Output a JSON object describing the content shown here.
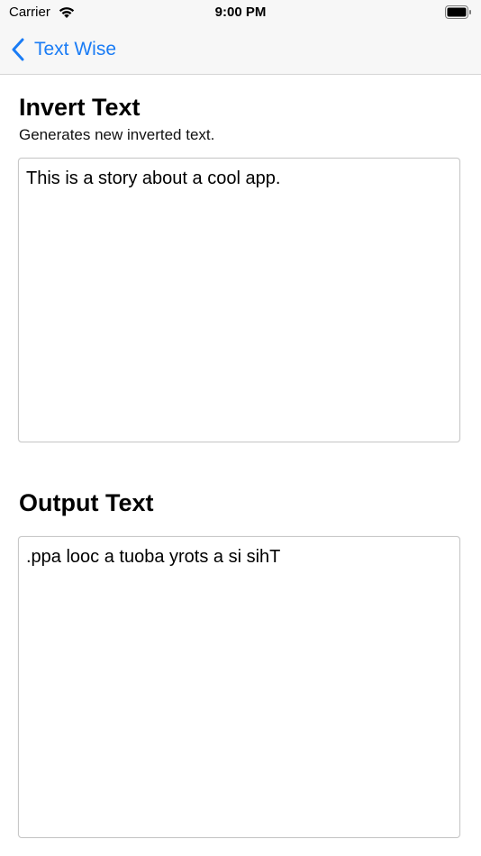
{
  "status_bar": {
    "carrier": "Carrier",
    "time": "9:00 PM",
    "wifi_icon": "wifi-icon",
    "battery_icon": "battery-full-icon"
  },
  "nav": {
    "back_label": "Text Wise",
    "back_icon": "chevron-left-icon",
    "accent_color": "#1a7cf5"
  },
  "invert": {
    "title": "Invert Text",
    "subtitle": "Generates new inverted text.",
    "input_value": "This is a story about a cool app."
  },
  "output": {
    "title": "Output Text",
    "output_value": ".ppa looc a tuoba yrots a si sihT"
  }
}
